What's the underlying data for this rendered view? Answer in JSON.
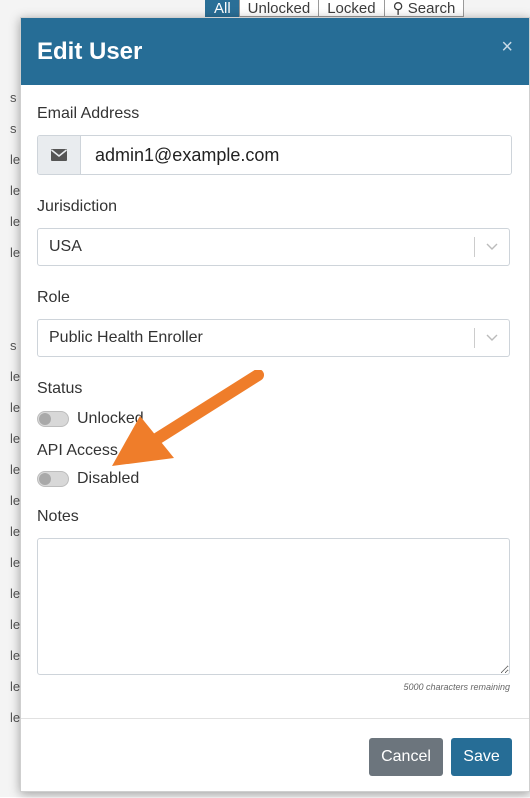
{
  "background": {
    "tabs": [
      "All",
      "Unlocked",
      "Locked",
      "Search"
    ],
    "row_letters": [
      "s",
      "s",
      "le",
      "le",
      "le",
      "le",
      "",
      "",
      "s",
      "le",
      "le",
      "le",
      "le",
      "le",
      "le",
      "le",
      "le",
      "le",
      "le",
      "le",
      "le"
    ]
  },
  "modal": {
    "title": "Edit User",
    "close_glyph": "×",
    "email": {
      "label": "Email Address",
      "value": "admin1@example.com"
    },
    "jurisdiction": {
      "label": "Jurisdiction",
      "value": "USA"
    },
    "role": {
      "label": "Role",
      "value": "Public Health Enroller"
    },
    "status": {
      "label": "Status",
      "toggle_text": "Unlocked",
      "enabled": false
    },
    "api_access": {
      "label": "API Access",
      "toggle_text": "Disabled",
      "enabled": false
    },
    "notes": {
      "label": "Notes",
      "value": "",
      "chars_remaining": "5000 characters remaining"
    },
    "buttons": {
      "cancel": "Cancel",
      "save": "Save"
    }
  },
  "icons": {
    "email": "envelope-icon",
    "dropdown": "chevron-down-icon",
    "close": "close-icon",
    "annotation": "arrow-annotation"
  },
  "colors": {
    "header": "#266d96",
    "cancel": "#6c757d",
    "save": "#266d96",
    "arrow": "#ef7d2a"
  }
}
